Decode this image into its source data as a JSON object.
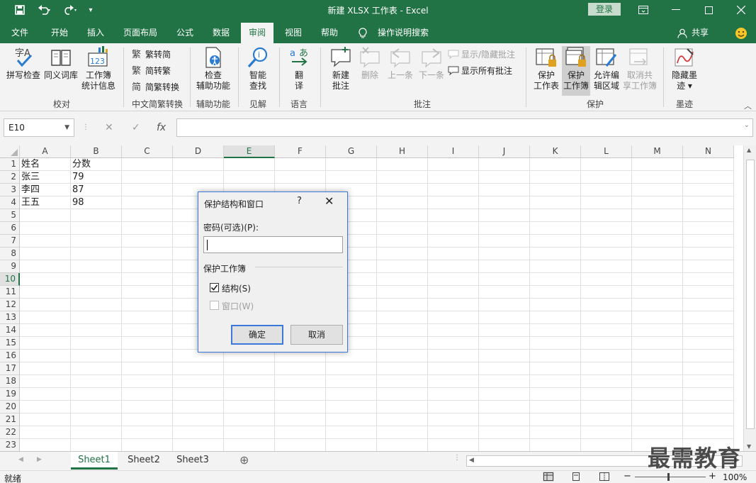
{
  "title_bar": {
    "title": "新建 XLSX 工作表  -  Excel",
    "login": "登录",
    "save_icon": "save-icon",
    "undo_icon": "undo-icon",
    "redo_icon": "redo-icon",
    "customize_icon": "customize-toolbar-icon"
  },
  "menu": {
    "tabs": [
      "文件",
      "开始",
      "插入",
      "页面布局",
      "公式",
      "数据",
      "审阅",
      "视图",
      "帮助"
    ],
    "active": "审阅",
    "tell_me": "操作说明搜索",
    "share": "共享"
  },
  "ribbon": {
    "groups": {
      "proofing": "校对",
      "chinese_conversion": "中文简繁转换",
      "accessibility": "辅助功能",
      "insights": "见解",
      "language": "语言",
      "comments": "批注",
      "protect": "保护",
      "ink": "墨迹"
    },
    "buttons": {
      "spell_check": "拼写检查",
      "thesaurus": "同义词库",
      "workbook_stats": "工作簿\n统计信息",
      "trad_to_simp": "繁转简",
      "simp_to_trad": "简转繁",
      "convert": "简繁转换",
      "check_accessibility": "检查\n辅助功能",
      "smart_lookup": "智能\n查找",
      "translate": "翻\n译",
      "new_comment": "新建\n批注",
      "delete": "删除",
      "previous": "上一条",
      "next": "下一条",
      "show_hide_comment": "显示/隐藏批注",
      "show_all_comments": "显示所有批注",
      "protect_sheet": "保护\n工作表",
      "protect_workbook": "保护\n工作簿",
      "allow_edit_ranges": "允许编\n辑区域",
      "unshare_workbook": "取消共\n享工作簿",
      "hide_ink": "隐藏墨\n迹 ▾"
    }
  },
  "formula_bar": {
    "name_box": "E10",
    "cancel": "✕",
    "enter": "✓",
    "fx": "fx",
    "formula": ""
  },
  "grid": {
    "columns": [
      "A",
      "B",
      "C",
      "D",
      "E",
      "F",
      "G",
      "H",
      "I",
      "J",
      "K",
      "L",
      "M",
      "N"
    ],
    "rows": [
      "1",
      "2",
      "3",
      "4",
      "5",
      "6",
      "7",
      "8",
      "9",
      "10",
      "11",
      "12",
      "13",
      "14",
      "15",
      "16",
      "17",
      "18",
      "19",
      "20",
      "21",
      "22",
      "23"
    ],
    "selected_column": "E",
    "selected_row": "10",
    "cells": [
      {
        "col": "A",
        "row": "1",
        "value": "姓名"
      },
      {
        "col": "B",
        "row": "1",
        "value": "分数"
      },
      {
        "col": "A",
        "row": "2",
        "value": "张三"
      },
      {
        "col": "B",
        "row": "2",
        "value": "79"
      },
      {
        "col": "A",
        "row": "3",
        "value": "李四"
      },
      {
        "col": "B",
        "row": "3",
        "value": "87"
      },
      {
        "col": "A",
        "row": "4",
        "value": "王五"
      },
      {
        "col": "B",
        "row": "4",
        "value": "98"
      }
    ]
  },
  "sheets": {
    "tabs": [
      "Sheet1",
      "Sheet2",
      "Sheet3"
    ],
    "active": "Sheet1",
    "add": "⊕"
  },
  "status_bar": {
    "ready": "就绪",
    "zoom": "100%"
  },
  "dialog": {
    "title": "保护结构和窗口",
    "help": "?",
    "close": "✕",
    "password_label": "密码(可选)(P):",
    "password_value": "",
    "section": "保护工作簿",
    "structure_label": "结构(S)",
    "structure_checked": true,
    "window_label": "窗口(W)",
    "window_checked": false,
    "window_enabled": false,
    "ok": "确定",
    "cancel": "取消"
  },
  "watermark": "最需教育",
  "colors": {
    "brand": "#217346",
    "dialog_accent": "#3c78d8"
  }
}
